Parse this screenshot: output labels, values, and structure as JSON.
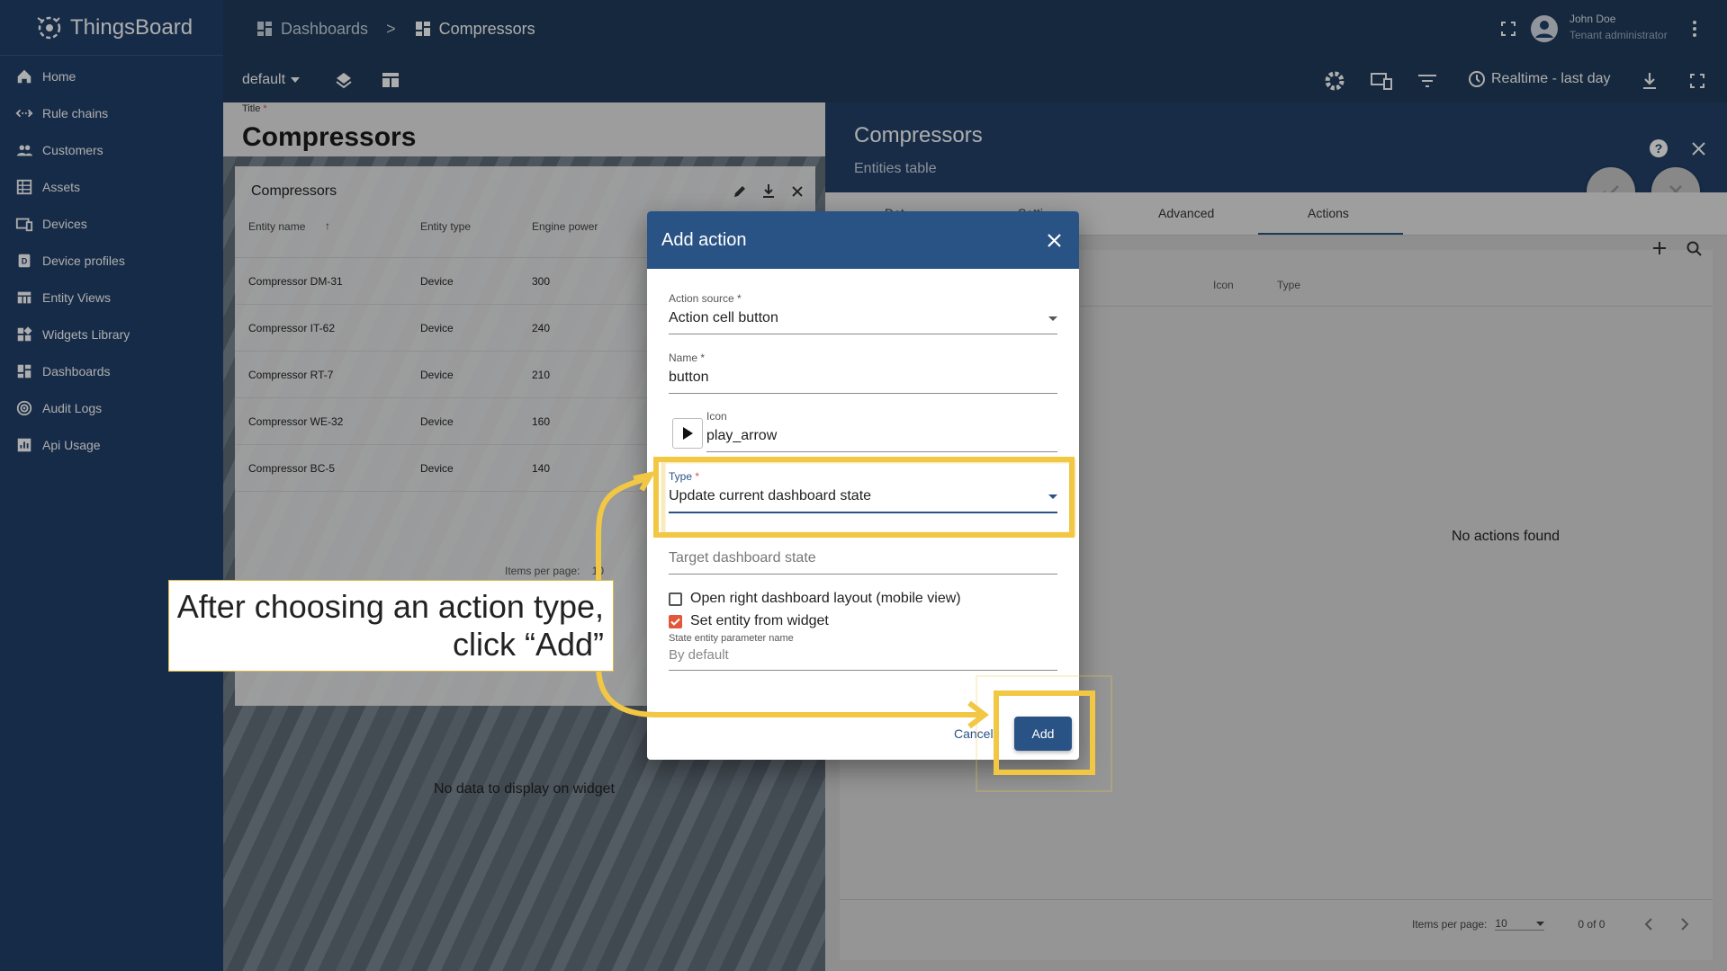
{
  "app": {
    "name": "ThingsBoard"
  },
  "sidebar": {
    "items": [
      {
        "label": "Home",
        "icon": "home-icon"
      },
      {
        "label": "Rule chains",
        "icon": "rule-chains-icon"
      },
      {
        "label": "Customers",
        "icon": "customers-icon"
      },
      {
        "label": "Assets",
        "icon": "assets-icon"
      },
      {
        "label": "Devices",
        "icon": "devices-icon"
      },
      {
        "label": "Device profiles",
        "icon": "device-profiles-icon"
      },
      {
        "label": "Entity Views",
        "icon": "entity-views-icon"
      },
      {
        "label": "Widgets Library",
        "icon": "widgets-icon"
      },
      {
        "label": "Dashboards",
        "icon": "dashboards-icon"
      },
      {
        "label": "Audit Logs",
        "icon": "audit-logs-icon"
      },
      {
        "label": "Api Usage",
        "icon": "api-usage-icon"
      }
    ]
  },
  "topbar": {
    "breadcrumb_root": "Dashboards",
    "breadcrumb_sep": ">",
    "breadcrumb_current": "Compressors",
    "user_name": "John Doe",
    "user_role": "Tenant administrator"
  },
  "toolbar": {
    "state": "default",
    "timewindow": "Realtime - last day"
  },
  "dashboard": {
    "title_label": "Title",
    "title": "Compressors",
    "widget": {
      "title": "Compressors",
      "columns": [
        "Entity name",
        "Entity type",
        "Engine power"
      ],
      "rows": [
        [
          "Compressor DM-31",
          "Device",
          "300"
        ],
        [
          "Compressor IT-62",
          "Device",
          "240"
        ],
        [
          "Compressor RT-7",
          "Device",
          "210"
        ],
        [
          "Compressor WE-32",
          "Device",
          "160"
        ],
        [
          "Compressor BC-5",
          "Device",
          "140"
        ]
      ],
      "items_per_page_label": "Items per page:",
      "items_per_page": "10"
    },
    "no_data": "No data to display on widget"
  },
  "right_panel": {
    "title": "Compressors",
    "subtitle": "Entities table",
    "tabs": [
      "Data",
      "Settings",
      "Advanced",
      "Actions"
    ],
    "tabs_visible": [
      "Dat",
      "Setti",
      "Advanced",
      "Actions"
    ],
    "columns": [
      "Icon",
      "Type"
    ],
    "empty_text": "No actions found",
    "items_per_page_label": "Items per page:",
    "items_per_page": "10",
    "range": "0 of 0"
  },
  "dialog": {
    "title": "Add action",
    "action_source_label": "Action source",
    "action_source": "Action cell button",
    "name_label": "Name",
    "name": "button",
    "icon_label": "Icon",
    "icon": "play_arrow",
    "type_label": "Type",
    "type": "Update current dashboard state",
    "target_state_placeholder": "Target dashboard state",
    "open_right_layout_label": "Open right dashboard layout (mobile view)",
    "open_right_layout_checked": false,
    "set_entity_label": "Set entity from widget",
    "set_entity_checked": true,
    "state_param_label": "State entity parameter name",
    "state_param_placeholder": "By default",
    "cancel": "Cancel",
    "add": "Add"
  },
  "annotation": {
    "line1": "After choosing an action type,",
    "line2": "click “Add”",
    "color": "#f2c744"
  }
}
